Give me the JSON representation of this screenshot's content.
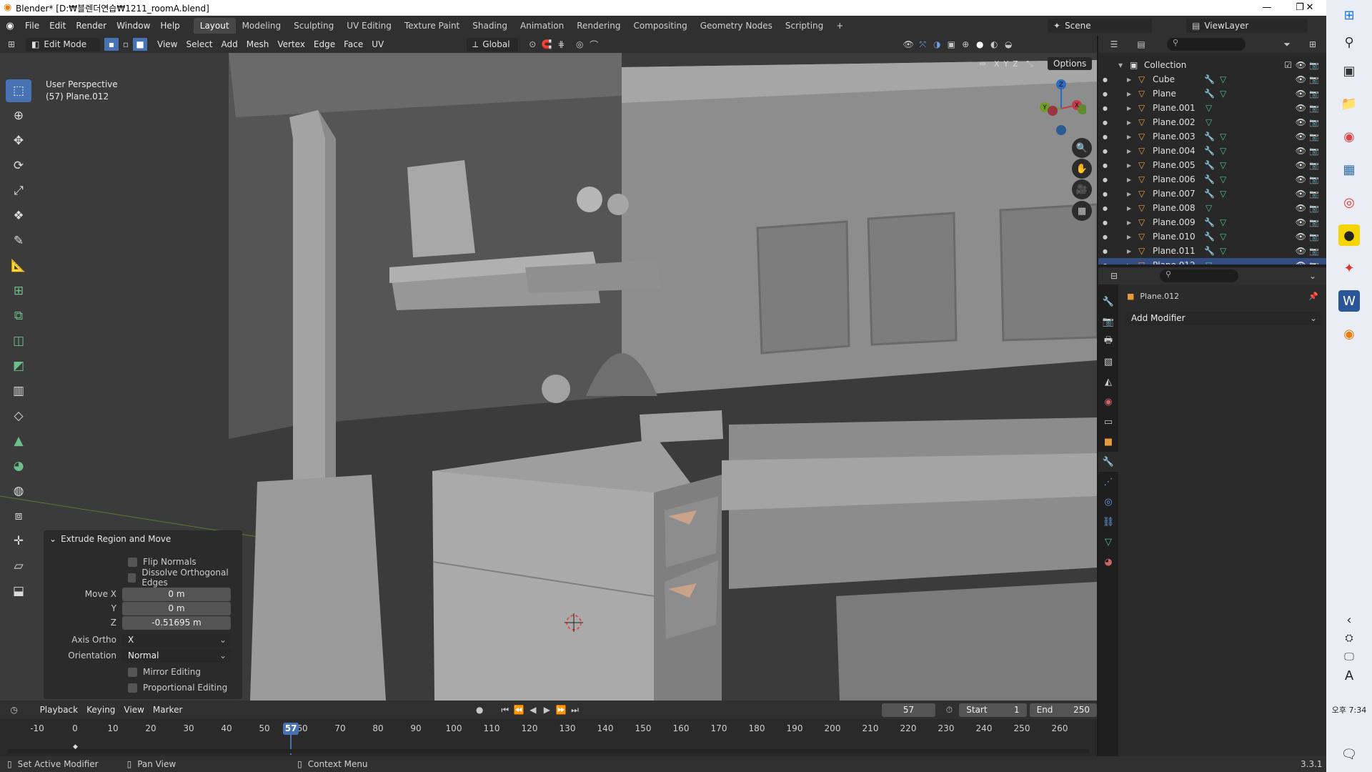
{
  "window": {
    "title": "Blender* [D:₩블렌더연습₩1211_roomA.blend]",
    "min": "—",
    "max": "❐",
    "close": "✕"
  },
  "menu": {
    "items": [
      "File",
      "Edit",
      "Render",
      "Window",
      "Help"
    ],
    "workspaces": [
      "Layout",
      "Modeling",
      "Sculpting",
      "UV Editing",
      "Texture Paint",
      "Shading",
      "Animation",
      "Rendering",
      "Compositing",
      "Geometry Nodes",
      "Scripting"
    ],
    "active_workspace": "Layout",
    "add_workspace": "+",
    "scene": "Scene",
    "viewlayer": "ViewLayer"
  },
  "viewport_header": {
    "mode": "Edit Mode",
    "menus": [
      "View",
      "Select",
      "Add",
      "Mesh",
      "Vertex",
      "Edge",
      "Face",
      "UV"
    ],
    "orientation": "Global",
    "options": "Options",
    "axes": [
      "X",
      "Y",
      "Z"
    ]
  },
  "viewport": {
    "perspective": "User Perspective",
    "object": "(57) Plane.012"
  },
  "gizmo": {
    "x": "X",
    "y": "Y",
    "z": "Z"
  },
  "operator": {
    "title": "Extrude Region and Move",
    "flip_normals": "Flip Normals",
    "dissolve": "Dissolve Orthogonal Edges",
    "move_x_label": "Move X",
    "move_x": "0 m",
    "y_label": "Y",
    "y": "0 m",
    "z_label": "Z",
    "z": "-0.51695 m",
    "axis_ortho_label": "Axis Ortho",
    "axis_ortho": "X",
    "orientation_label": "Orientation",
    "orientation": "Normal",
    "mirror": "Mirror Editing",
    "proportional": "Proportional Editing"
  },
  "timeline": {
    "menus": [
      "Playback",
      "Keying",
      "View",
      "Marker"
    ],
    "current_frame": "57",
    "start_label": "Start",
    "start": "1",
    "end_label": "End",
    "end": "250",
    "ticks": [
      "-10",
      "0",
      "10",
      "20",
      "30",
      "40",
      "50",
      "60",
      "70",
      "80",
      "90",
      "100",
      "110",
      "120",
      "130",
      "140",
      "150",
      "160",
      "170",
      "180",
      "190",
      "200",
      "210",
      "220",
      "230",
      "240",
      "250",
      "260"
    ],
    "playhead": "57"
  },
  "status": {
    "left": "Set Active Modifier",
    "mid": "Pan View",
    "right": "Context Menu",
    "version": "3.3.1"
  },
  "outliner": {
    "collection": "Collection",
    "items": [
      {
        "name": "Cube",
        "modifier": true
      },
      {
        "name": "Plane",
        "modifier": true
      },
      {
        "name": "Plane.001",
        "modifier": false
      },
      {
        "name": "Plane.002",
        "modifier": false
      },
      {
        "name": "Plane.003",
        "modifier": true
      },
      {
        "name": "Plane.004",
        "modifier": true
      },
      {
        "name": "Plane.005",
        "modifier": true
      },
      {
        "name": "Plane.006",
        "modifier": true
      },
      {
        "name": "Plane.007",
        "modifier": true
      },
      {
        "name": "Plane.008",
        "modifier": false
      },
      {
        "name": "Plane.009",
        "modifier": true
      },
      {
        "name": "Plane.010",
        "modifier": true
      },
      {
        "name": "Plane.011",
        "modifier": true
      },
      {
        "name": "Plane.012",
        "modifier": false
      }
    ]
  },
  "properties": {
    "object": "Plane.012",
    "add_modifier": "Add Modifier"
  },
  "taskbar": {
    "time_ampm": "오후",
    "time": "7:34",
    "lang": "A"
  },
  "colors": {
    "accent": "#4772b3",
    "mesh": "#e59a3c",
    "modifier": "#6d9ee0",
    "meshdata": "#4dc08f",
    "x_axis": "#c33c4b",
    "y_axis": "#6e9d2a",
    "z_axis": "#2e6bbf"
  }
}
